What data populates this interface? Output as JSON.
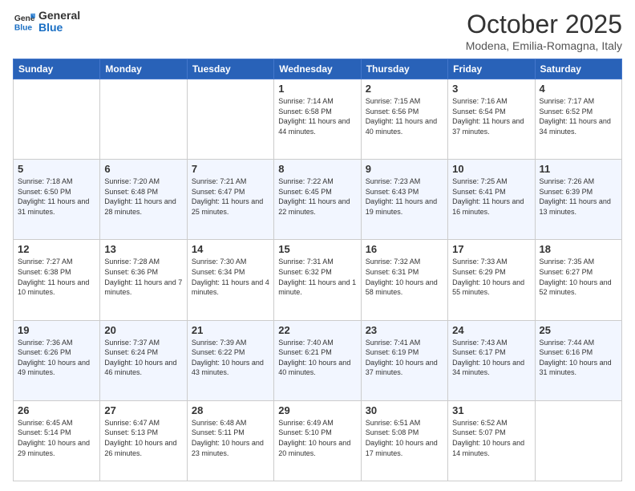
{
  "header": {
    "logo_general": "General",
    "logo_blue": "Blue",
    "month": "October 2025",
    "location": "Modena, Emilia-Romagna, Italy"
  },
  "weekdays": [
    "Sunday",
    "Monday",
    "Tuesday",
    "Wednesday",
    "Thursday",
    "Friday",
    "Saturday"
  ],
  "weeks": [
    [
      {
        "day": "",
        "sunrise": "",
        "sunset": "",
        "daylight": ""
      },
      {
        "day": "",
        "sunrise": "",
        "sunset": "",
        "daylight": ""
      },
      {
        "day": "",
        "sunrise": "",
        "sunset": "",
        "daylight": ""
      },
      {
        "day": "1",
        "sunrise": "Sunrise: 7:14 AM",
        "sunset": "Sunset: 6:58 PM",
        "daylight": "Daylight: 11 hours and 44 minutes."
      },
      {
        "day": "2",
        "sunrise": "Sunrise: 7:15 AM",
        "sunset": "Sunset: 6:56 PM",
        "daylight": "Daylight: 11 hours and 40 minutes."
      },
      {
        "day": "3",
        "sunrise": "Sunrise: 7:16 AM",
        "sunset": "Sunset: 6:54 PM",
        "daylight": "Daylight: 11 hours and 37 minutes."
      },
      {
        "day": "4",
        "sunrise": "Sunrise: 7:17 AM",
        "sunset": "Sunset: 6:52 PM",
        "daylight": "Daylight: 11 hours and 34 minutes."
      }
    ],
    [
      {
        "day": "5",
        "sunrise": "Sunrise: 7:18 AM",
        "sunset": "Sunset: 6:50 PM",
        "daylight": "Daylight: 11 hours and 31 minutes."
      },
      {
        "day": "6",
        "sunrise": "Sunrise: 7:20 AM",
        "sunset": "Sunset: 6:48 PM",
        "daylight": "Daylight: 11 hours and 28 minutes."
      },
      {
        "day": "7",
        "sunrise": "Sunrise: 7:21 AM",
        "sunset": "Sunset: 6:47 PM",
        "daylight": "Daylight: 11 hours and 25 minutes."
      },
      {
        "day": "8",
        "sunrise": "Sunrise: 7:22 AM",
        "sunset": "Sunset: 6:45 PM",
        "daylight": "Daylight: 11 hours and 22 minutes."
      },
      {
        "day": "9",
        "sunrise": "Sunrise: 7:23 AM",
        "sunset": "Sunset: 6:43 PM",
        "daylight": "Daylight: 11 hours and 19 minutes."
      },
      {
        "day": "10",
        "sunrise": "Sunrise: 7:25 AM",
        "sunset": "Sunset: 6:41 PM",
        "daylight": "Daylight: 11 hours and 16 minutes."
      },
      {
        "day": "11",
        "sunrise": "Sunrise: 7:26 AM",
        "sunset": "Sunset: 6:39 PM",
        "daylight": "Daylight: 11 hours and 13 minutes."
      }
    ],
    [
      {
        "day": "12",
        "sunrise": "Sunrise: 7:27 AM",
        "sunset": "Sunset: 6:38 PM",
        "daylight": "Daylight: 11 hours and 10 minutes."
      },
      {
        "day": "13",
        "sunrise": "Sunrise: 7:28 AM",
        "sunset": "Sunset: 6:36 PM",
        "daylight": "Daylight: 11 hours and 7 minutes."
      },
      {
        "day": "14",
        "sunrise": "Sunrise: 7:30 AM",
        "sunset": "Sunset: 6:34 PM",
        "daylight": "Daylight: 11 hours and 4 minutes."
      },
      {
        "day": "15",
        "sunrise": "Sunrise: 7:31 AM",
        "sunset": "Sunset: 6:32 PM",
        "daylight": "Daylight: 11 hours and 1 minute."
      },
      {
        "day": "16",
        "sunrise": "Sunrise: 7:32 AM",
        "sunset": "Sunset: 6:31 PM",
        "daylight": "Daylight: 10 hours and 58 minutes."
      },
      {
        "day": "17",
        "sunrise": "Sunrise: 7:33 AM",
        "sunset": "Sunset: 6:29 PM",
        "daylight": "Daylight: 10 hours and 55 minutes."
      },
      {
        "day": "18",
        "sunrise": "Sunrise: 7:35 AM",
        "sunset": "Sunset: 6:27 PM",
        "daylight": "Daylight: 10 hours and 52 minutes."
      }
    ],
    [
      {
        "day": "19",
        "sunrise": "Sunrise: 7:36 AM",
        "sunset": "Sunset: 6:26 PM",
        "daylight": "Daylight: 10 hours and 49 minutes."
      },
      {
        "day": "20",
        "sunrise": "Sunrise: 7:37 AM",
        "sunset": "Sunset: 6:24 PM",
        "daylight": "Daylight: 10 hours and 46 minutes."
      },
      {
        "day": "21",
        "sunrise": "Sunrise: 7:39 AM",
        "sunset": "Sunset: 6:22 PM",
        "daylight": "Daylight: 10 hours and 43 minutes."
      },
      {
        "day": "22",
        "sunrise": "Sunrise: 7:40 AM",
        "sunset": "Sunset: 6:21 PM",
        "daylight": "Daylight: 10 hours and 40 minutes."
      },
      {
        "day": "23",
        "sunrise": "Sunrise: 7:41 AM",
        "sunset": "Sunset: 6:19 PM",
        "daylight": "Daylight: 10 hours and 37 minutes."
      },
      {
        "day": "24",
        "sunrise": "Sunrise: 7:43 AM",
        "sunset": "Sunset: 6:17 PM",
        "daylight": "Daylight: 10 hours and 34 minutes."
      },
      {
        "day": "25",
        "sunrise": "Sunrise: 7:44 AM",
        "sunset": "Sunset: 6:16 PM",
        "daylight": "Daylight: 10 hours and 31 minutes."
      }
    ],
    [
      {
        "day": "26",
        "sunrise": "Sunrise: 6:45 AM",
        "sunset": "Sunset: 5:14 PM",
        "daylight": "Daylight: 10 hours and 29 minutes."
      },
      {
        "day": "27",
        "sunrise": "Sunrise: 6:47 AM",
        "sunset": "Sunset: 5:13 PM",
        "daylight": "Daylight: 10 hours and 26 minutes."
      },
      {
        "day": "28",
        "sunrise": "Sunrise: 6:48 AM",
        "sunset": "Sunset: 5:11 PM",
        "daylight": "Daylight: 10 hours and 23 minutes."
      },
      {
        "day": "29",
        "sunrise": "Sunrise: 6:49 AM",
        "sunset": "Sunset: 5:10 PM",
        "daylight": "Daylight: 10 hours and 20 minutes."
      },
      {
        "day": "30",
        "sunrise": "Sunrise: 6:51 AM",
        "sunset": "Sunset: 5:08 PM",
        "daylight": "Daylight: 10 hours and 17 minutes."
      },
      {
        "day": "31",
        "sunrise": "Sunrise: 6:52 AM",
        "sunset": "Sunset: 5:07 PM",
        "daylight": "Daylight: 10 hours and 14 minutes."
      },
      {
        "day": "",
        "sunrise": "",
        "sunset": "",
        "daylight": ""
      }
    ]
  ]
}
